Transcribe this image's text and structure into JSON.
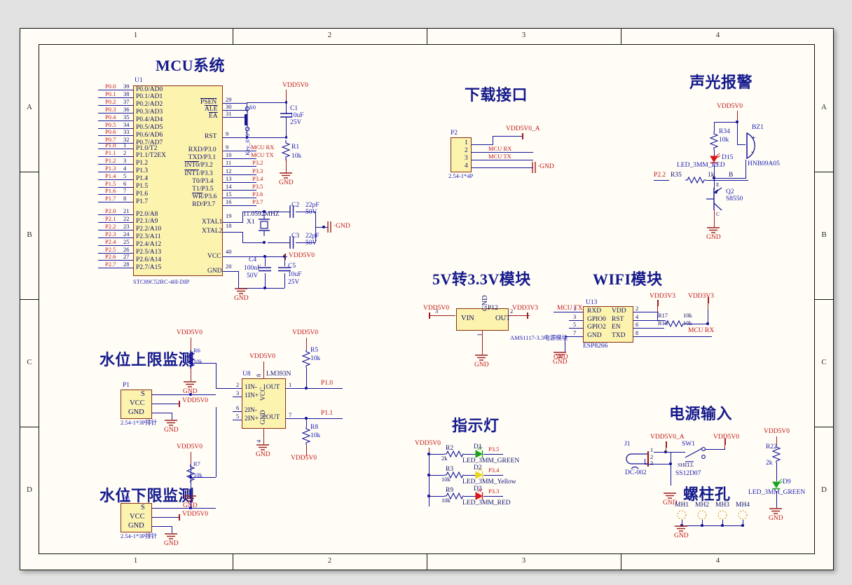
{
  "sheet": {
    "columns": [
      "1",
      "2",
      "3",
      "4"
    ],
    "rows": [
      "A",
      "B",
      "C",
      "D"
    ],
    "bg_color": "#fffdf5",
    "page_bg": "#e2e2e2"
  },
  "colors": {
    "wire": "#14149b",
    "power_wire": "#9c1c1c",
    "component_body": "#fcf3ae",
    "component_border": "#8a2f12",
    "title": "#151a8c",
    "net_label": "#c21515",
    "designator": "#1b1bb5"
  },
  "blocks": {
    "mcu": {
      "title": "MCU系统",
      "designator": "U1",
      "part": "STC89C52RC-40I-DIP",
      "left_nets": [
        "P0.0",
        "P0.1",
        "P0.2",
        "P0.3",
        "P0.4",
        "P0.5",
        "P0.6",
        "P0.7",
        "P1.0",
        "P1.1",
        "P1.2",
        "P1.3",
        "P1.4",
        "P1.5",
        "P1.6",
        "P1.7",
        "P2.0",
        "P2.1",
        "P2.2",
        "P2.3",
        "P2.4",
        "P2.5",
        "P2.6",
        "P2.7"
      ],
      "left_pin_numbers": [
        "39",
        "38",
        "37",
        "36",
        "35",
        "34",
        "33",
        "32",
        "1",
        "2",
        "3",
        "4",
        "5",
        "6",
        "7",
        "8",
        "21",
        "22",
        "23",
        "24",
        "25",
        "26",
        "27",
        "28"
      ],
      "left_pin_names": [
        "P0.0/AD0",
        "P0.1/AD1",
        "P0.2/AD2",
        "P0.3/AD3",
        "P0.4/AD4",
        "P0.5/AD5",
        "P0.6/AD6",
        "P0.7/AD7",
        "P1.0/T2",
        "P1.1/T2EX",
        "P1.2",
        "P1.3",
        "P1.4",
        "P1.5",
        "P1.6",
        "P1.7",
        "P2.0/A8",
        "P2.1/A9",
        "P2.2/A10",
        "P2.3/A11",
        "P2.4/A12",
        "P2.5/A13",
        "P2.6/A14",
        "P2.7/A15"
      ],
      "right_pin_names": [
        "PSEN",
        "ALE",
        "EA",
        "RST",
        "RXD/P3.0",
        "TXD/P3.1",
        "INT0/P3.2",
        "INT1/P3.3",
        "T0/P3.4",
        "T1/P3.5",
        "WR/P3.6",
        "RD/P3.7",
        "XTAL1",
        "XTAL2",
        "VCC",
        "GND"
      ],
      "right_pin_numbers": [
        "29",
        "30",
        "31",
        "9",
        "10",
        "11",
        "12",
        "13",
        "14",
        "15",
        "16",
        "17",
        "19",
        "18",
        "40",
        "20"
      ],
      "right_nets": [
        "MCU RX",
        "MCU TX",
        "P3.2",
        "P3.3",
        "P3.4",
        "P3.5",
        "P3.6",
        "P3.7"
      ],
      "reset": {
        "key": "Key_6*6*5",
        "key_designator": "S0",
        "cap": "C1",
        "cap_value": "10uF",
        "cap_voltage": "25V",
        "res": "R1",
        "res_value": "10k",
        "power": "VDD5V0",
        "gnd": "GND"
      },
      "crystal": {
        "designator": "X1",
        "value": "11.0592MHZ",
        "c2": "C2",
        "c2_value": "22pF",
        "c2_voltage": "50V",
        "c3": "C3",
        "c3_value": "22pF",
        "c3_voltage": "50V",
        "gnd": "GND"
      },
      "decoupling": {
        "c4": "C4",
        "c4_value": "100nF",
        "c4_voltage": "50V",
        "c5": "C5",
        "c5_value": "10uF",
        "c5_voltage": "25V",
        "power": "VDD5V0",
        "gnd": "GND"
      }
    },
    "download": {
      "title": "下载接口",
      "designator": "P2",
      "footprint": "2.54-1*4P",
      "pins": [
        "1",
        "2",
        "3",
        "4"
      ],
      "nets": [
        "VDD5V0_A",
        "MCU RX",
        "MCU TX",
        "GND"
      ]
    },
    "alarm": {
      "title": "声光报警",
      "power": "VDD5V0",
      "r34": "R34",
      "r34_value": "10k",
      "led": "D15",
      "led_part": "LED_3MM_RED",
      "buzzer": "BZ1",
      "buzzer_part": "HNB09A05",
      "buzzer_plus": "+",
      "buzzer_minus": "-",
      "input_net": "P2.2",
      "r35": "R35",
      "r35_value": "1k",
      "base_label": "B",
      "emitter_label": "E",
      "collector_label": "C",
      "transistor": "Q2",
      "transistor_part": "S8550"
    },
    "ldo": {
      "title": "5V转3.3V模块",
      "designator": "P12",
      "part": "AMS1117-3.3电源模块",
      "pin_vin": "VIN",
      "pin_gnd": "GND",
      "pin_out": "OUT",
      "pin_num_in": "3",
      "pin_num_out": "2",
      "pin_num_gnd": "1",
      "net_in": "VDD5V0",
      "net_out": "VDD3V3",
      "gnd": "GND"
    },
    "wifi": {
      "title": "WIFI模块",
      "designator": "U13",
      "part": "ESP8266",
      "left_pins": [
        "RXD",
        "GPIO0",
        "GPIO2",
        "GND"
      ],
      "left_pin_numbers": [
        "1",
        "3",
        "5",
        "7"
      ],
      "right_pins": [
        "VDD",
        "RST",
        "EN",
        "TXD"
      ],
      "right_pin_numbers": [
        "2",
        "4",
        "6",
        "8"
      ],
      "net_tx": "MCU TX",
      "net_rx": "MCU RX",
      "power1": "VDD3V3",
      "power2": "VDD3V3",
      "r17": "R17",
      "r17_value": "10k",
      "r18": "R18",
      "r18_value": "10k",
      "gnd": "GND"
    },
    "water_high": {
      "title": "水位上限监测",
      "connector": "P1",
      "connector_pins": [
        "S",
        "VCC",
        "GND"
      ],
      "footprint": "2.54-1*3P排针",
      "resistor": "R6",
      "resistor_value": "10k",
      "power": "VDD5V0",
      "gnd": "GND",
      "vcc_net": "VDD5V0"
    },
    "water_low": {
      "title": "水位下限监测",
      "connector": "P3",
      "connector_pins": [
        "S",
        "VCC",
        "GND"
      ],
      "footprint": "2.54-1*3P排针",
      "resistor": "R7",
      "resistor_value": "10k",
      "power": "VDD5V0",
      "gnd": "GND",
      "vcc_net": "VDD5V0"
    },
    "comparator": {
      "designator": "U8",
      "part": "LM393N",
      "left_pins": [
        "1IN-",
        "1IN+",
        "2IN-",
        "2IN+"
      ],
      "left_pin_numbers": [
        "2",
        "3",
        "6",
        "5"
      ],
      "right_pins": [
        "1OUT",
        "2OUT"
      ],
      "right_pin_numbers": [
        "1",
        "7"
      ],
      "vcc_label": "VCC",
      "gnd_label": "GND",
      "vcc_pin": "8",
      "gnd_pin": "4",
      "power": "VDD5V0",
      "gnd": "GND",
      "r5": "R5",
      "r5_value": "10k",
      "out1_net": "P1.0",
      "r8": "R8",
      "r8_value": "10k",
      "out2_net": "P1.1",
      "r8_power": "VDD5V0"
    },
    "indicators": {
      "title": "指示灯",
      "power": "VDD5V0",
      "rows": [
        {
          "res": "R2",
          "res_value": "2k",
          "led": "D1",
          "led_part": "LED_3MM_GREEN",
          "net": "P3.5",
          "color": "#19a319"
        },
        {
          "res": "R3",
          "res_value": "10k",
          "led": "D2",
          "led_part": "LED_3MM_Yellow",
          "net": "P3.4",
          "color": "#e8d21a"
        },
        {
          "res": "R9",
          "res_value": "10k",
          "led": "D3",
          "led_part": "LED_3MM_RED",
          "net": "P3.3",
          "color": "#d81515"
        }
      ]
    },
    "power_input": {
      "title": "电源输入",
      "jack": "J1",
      "jack_part": "DC-002",
      "jack_pins": [
        "1",
        "2",
        "3"
      ],
      "net_a": "VDD5V0_A",
      "switch": "SW1",
      "switch_part": "SS12D07",
      "switch_shell": "SHELL",
      "net_out": "VDD5V0",
      "gnd": "GND",
      "led_power": "VDD5V0",
      "r22": "R22",
      "r22_value": "2k",
      "led": "D9",
      "led_part": "LED_3MM_GREEN"
    },
    "mounting": {
      "title": "螺柱孔",
      "holes": [
        "MH1",
        "MH2",
        "MH3",
        "MH4"
      ],
      "gnd": "GND"
    }
  }
}
